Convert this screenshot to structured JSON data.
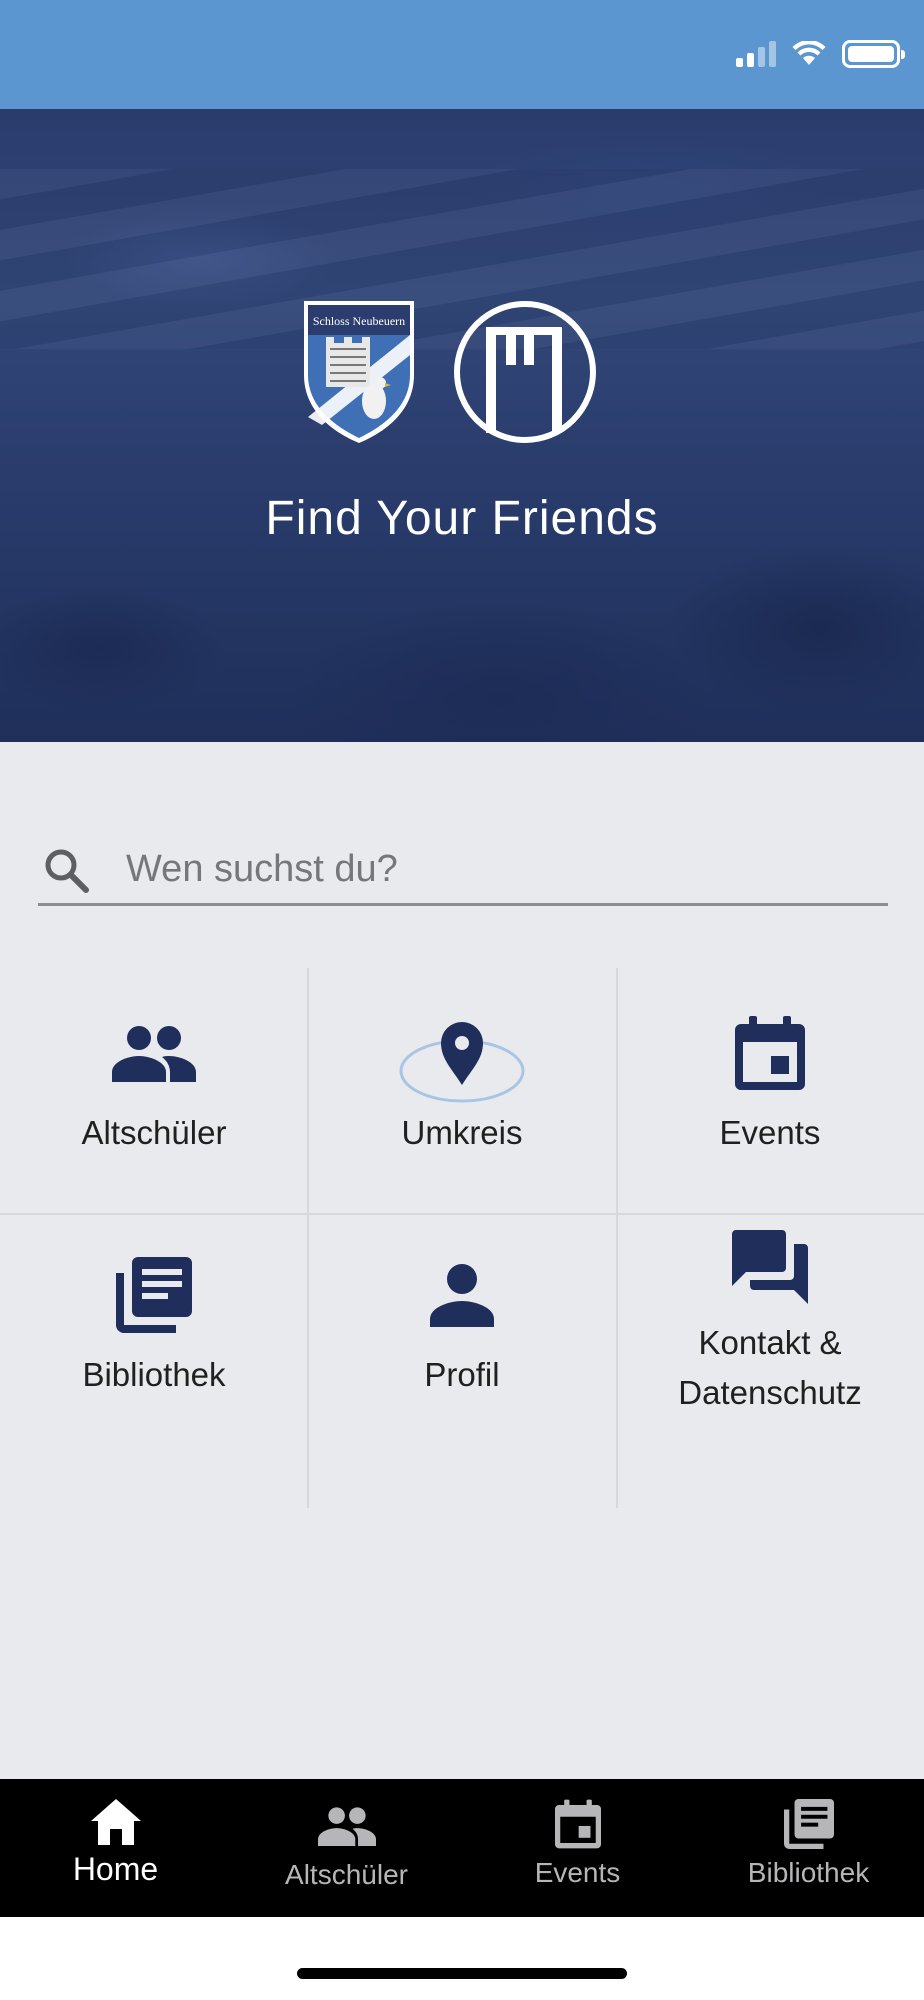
{
  "colors": {
    "status_bar": "#5b96d1",
    "hero_overlay": "#2a3c6c",
    "icon_navy": "#1f2e5a",
    "page_bg": "#e9eaee",
    "nav_bg": "#000000"
  },
  "status_bar": {
    "signal_icon": "cellular-signal",
    "wifi_icon": "wifi",
    "battery_icon": "battery-full"
  },
  "hero": {
    "crest_text": "Schloss Neubeuern",
    "title": "Find Your Friends"
  },
  "search": {
    "placeholder": "Wen suchst du?",
    "value": "",
    "icon": "search-icon"
  },
  "tiles": [
    {
      "label": "Altschüler",
      "icon": "people-icon"
    },
    {
      "label": "Umkreis",
      "icon": "location-radius-icon"
    },
    {
      "label": "Events",
      "icon": "calendar-icon"
    },
    {
      "label": "Bibliothek",
      "icon": "library-icon"
    },
    {
      "label": "Profil",
      "icon": "person-icon"
    },
    {
      "label_line1": "Kontakt &",
      "label_line2": "Datenschutz",
      "icon": "chat-icon"
    }
  ],
  "bottom_nav": [
    {
      "label": "Home",
      "icon": "home-icon",
      "active": true
    },
    {
      "label": "Altschüler",
      "icon": "people-icon",
      "active": false
    },
    {
      "label": "Events",
      "icon": "calendar-icon",
      "active": false
    },
    {
      "label": "Bibliothek",
      "icon": "library-icon",
      "active": false
    }
  ]
}
